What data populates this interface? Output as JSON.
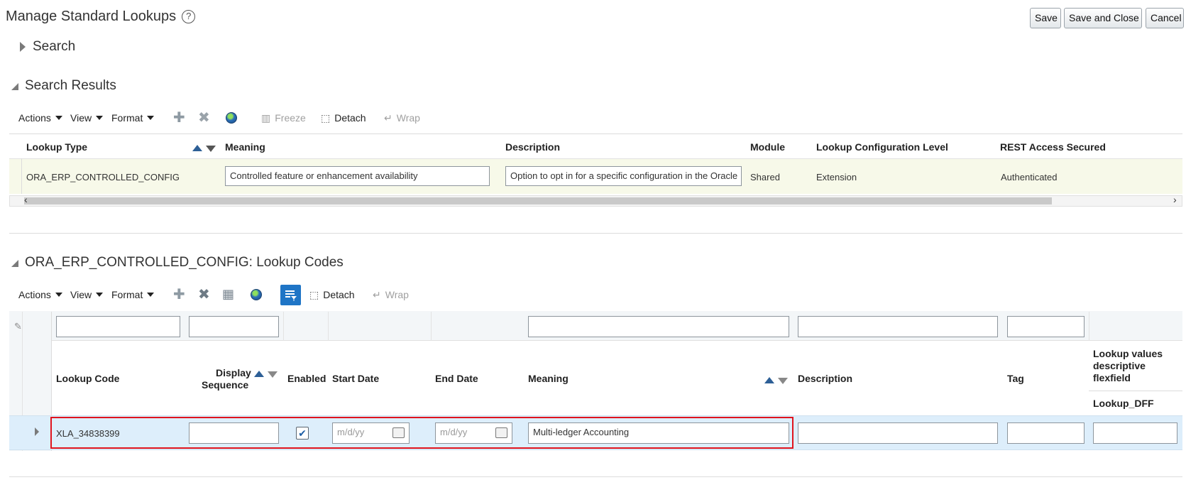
{
  "header": {
    "title": "Manage Standard Lookups",
    "help_icon": "?",
    "buttons": {
      "save": "Save",
      "save_close": "Save and Close",
      "cancel": "Cancel"
    }
  },
  "search_section": {
    "label": "Search"
  },
  "results_section": {
    "label": "Search Results",
    "toolbar": {
      "actions": "Actions",
      "view": "View",
      "format": "Format",
      "freeze": "Freeze",
      "detach": "Detach",
      "wrap": "Wrap"
    },
    "columns": {
      "lookup_type": "Lookup Type",
      "meaning": "Meaning",
      "description": "Description",
      "module": "Module",
      "config_level": "Lookup Configuration Level",
      "rest_access": "REST Access Secured"
    },
    "row": {
      "lookup_type": "ORA_ERP_CONTROLLED_CONFIG",
      "meaning": "Controlled feature or enhancement availability",
      "description": "Option to opt in for a specific configuration in the Oracle",
      "module": "Shared",
      "config_level": "Extension",
      "rest_access": "Authenticated"
    }
  },
  "codes_section": {
    "label": "ORA_ERP_CONTROLLED_CONFIG: Lookup Codes",
    "toolbar": {
      "actions": "Actions",
      "view": "View",
      "format": "Format",
      "detach": "Detach",
      "wrap": "Wrap"
    },
    "columns": {
      "lookup_code": "Lookup Code",
      "display_sequence_1": "Display",
      "display_sequence_2": "Sequence",
      "enabled": "Enabled",
      "start_date": "Start Date",
      "end_date": "End Date",
      "meaning": "Meaning",
      "description": "Description",
      "tag": "Tag",
      "dff_line1": "Lookup values",
      "dff_line2": "descriptive",
      "dff_line3": "flexfield",
      "dff_sub": "Lookup_DFF"
    },
    "row": {
      "lookup_code": "XLA_34838399",
      "display_sequence": "",
      "enabled": true,
      "start_date_placeholder": "m/d/yy",
      "end_date_placeholder": "m/d/yy",
      "meaning": "Multi-ledger Accounting",
      "description": "",
      "tag": ""
    },
    "highlight_color": "#e0141e"
  },
  "colors": {
    "selected_row": "#f7f9e9",
    "selected_row_codes": "#ddeefb",
    "accent": "#1f75c6"
  }
}
